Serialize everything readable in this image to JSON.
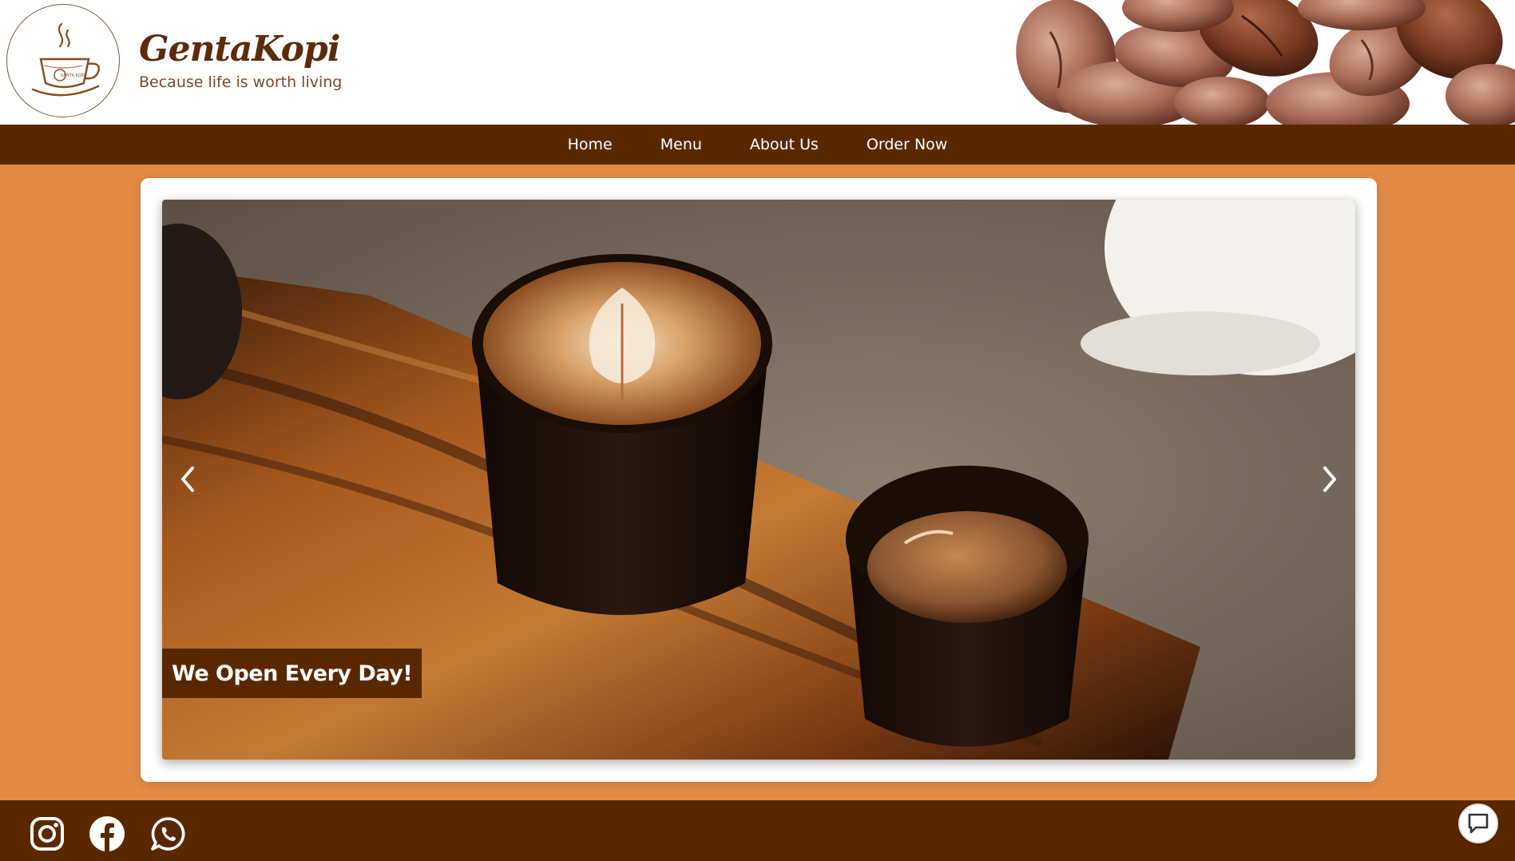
{
  "brand": {
    "name": "GentaKopi",
    "tagline": "Because life is worth living",
    "logo_text": "GENTA KOPI"
  },
  "nav": {
    "items": [
      {
        "label": "Home"
      },
      {
        "label": "Menu"
      },
      {
        "label": "About Us"
      },
      {
        "label": "Order Now"
      }
    ]
  },
  "carousel": {
    "caption": "We Open Every Day!",
    "prev_icon": "chevron-left-icon",
    "next_icon": "chevron-right-icon"
  },
  "footer": {
    "social": [
      "instagram-icon",
      "facebook-icon",
      "whatsapp-icon"
    ],
    "chat_icon": "chat-bubble-icon"
  },
  "colors": {
    "page_bg": "#e38a45",
    "brown": "#5a2800",
    "white": "#ffffff"
  }
}
